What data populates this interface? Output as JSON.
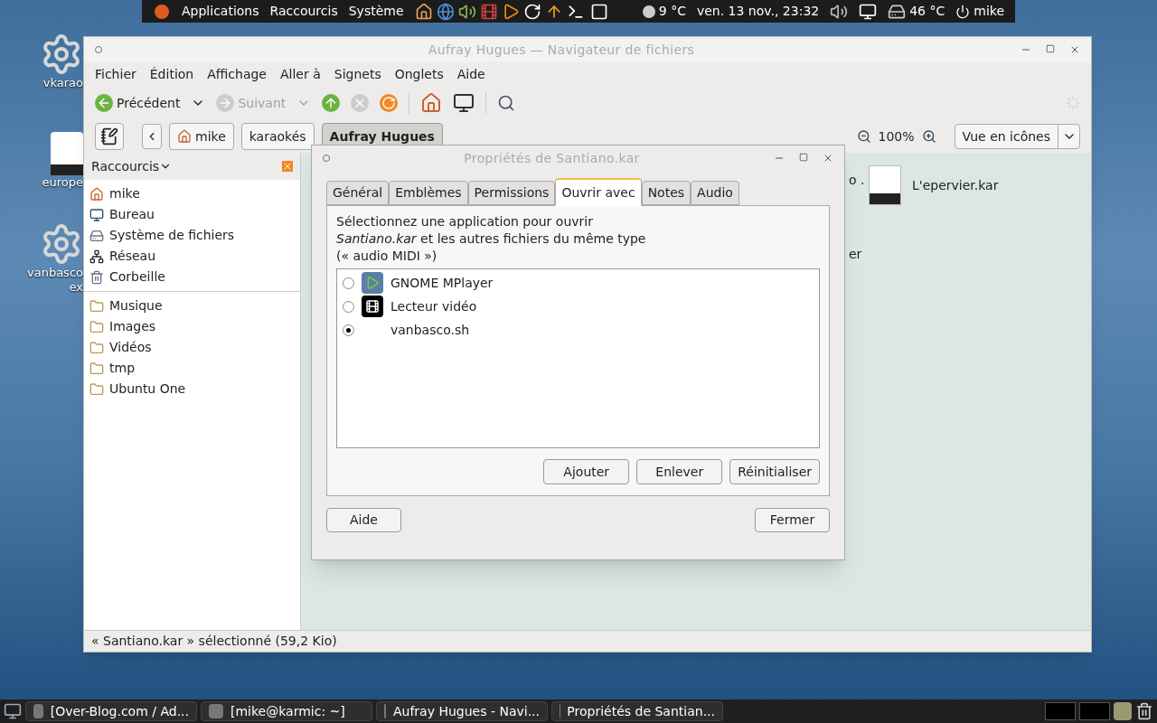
{
  "top_panel": {
    "menus": [
      "Applications",
      "Raccourcis",
      "Système"
    ],
    "weather": "9 °C",
    "clock": "ven. 13 nov., 23:32",
    "temperature": "46 °C",
    "user": "mike"
  },
  "desktop_icons": [
    {
      "kind": "gear",
      "lines": [
        "vkarao"
      ]
    },
    {
      "kind": "sound",
      "lines": [
        "europe"
      ]
    },
    {
      "kind": "gear",
      "lines": [
        "vanbasco",
        "ex"
      ]
    }
  ],
  "file_manager": {
    "title": "Aufray Hugues — Navigateur de fichiers",
    "menu": [
      "Fichier",
      "Édition",
      "Affichage",
      "Aller à",
      "Signets",
      "Onglets",
      "Aide"
    ],
    "toolbar": {
      "back": {
        "label": "Précédent",
        "disabled": false
      },
      "forward": {
        "label": "Suivant",
        "disabled": true
      }
    },
    "path": [
      {
        "label": "mike",
        "selected": false
      },
      {
        "label": "karaokés",
        "selected": false
      },
      {
        "label": "Aufray Hugues",
        "selected": true
      }
    ],
    "zoom": "100%",
    "view": "Vue en icônes",
    "sidebar": {
      "title": "Raccourcis",
      "places": [
        {
          "label": "mike",
          "kind": "home"
        },
        {
          "label": "Bureau",
          "kind": "desktop"
        },
        {
          "label": "Système de fichiers",
          "kind": "drive"
        },
        {
          "label": "Réseau",
          "kind": "network"
        },
        {
          "label": "Corbeille",
          "kind": "trash"
        }
      ],
      "bookmarks": [
        "Musique",
        "Images",
        "Vidéos",
        "tmp",
        "Ubuntu One"
      ]
    },
    "files": [
      {
        "name": "L'epervier.kar"
      }
    ],
    "partial_labels": [
      "o .",
      "er"
    ],
    "status_bar": "« Santiano.kar » sélectionné (59,2 Kio)"
  },
  "dialog": {
    "title": "Propriétés de Santiano.kar",
    "tabs": [
      {
        "label": "Général",
        "selected": false
      },
      {
        "label": "Emblèmes",
        "selected": false
      },
      {
        "label": "Permissions",
        "selected": false
      },
      {
        "label": "Ouvrir avec",
        "selected": true
      },
      {
        "label": "Notes",
        "selected": false
      },
      {
        "label": "Audio",
        "selected": false
      }
    ],
    "description": [
      "Sélectionnez une application pour ouvrir",
      "*Santiano.kar* et les autres fichiers du même type",
      "(« audio MIDI »)"
    ],
    "applications": [
      {
        "name": "GNOME MPlayer",
        "kind": "mplayer",
        "selected": false
      },
      {
        "name": "Lecteur vidéo",
        "kind": "totem",
        "selected": false
      },
      {
        "name": "vanbasco.sh",
        "kind": "none",
        "selected": true
      }
    ],
    "list_buttons": [
      "Ajouter",
      "Enlever",
      "Réinitialiser"
    ],
    "help": "Aide",
    "close": "Fermer"
  },
  "taskbar": [
    "[Over-Blog.com / Ad...",
    "[mike@karmic: ~]",
    "Aufray Hugues - Navi...",
    "Propriétés de Santian..."
  ]
}
